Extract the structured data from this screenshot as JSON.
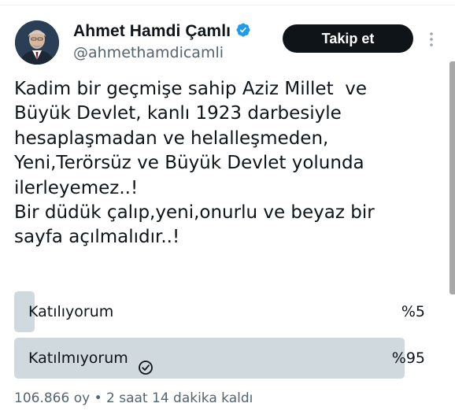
{
  "author": {
    "display_name": "Ahmet Hamdi Çamlı",
    "handle": "@ahmethamdicamli",
    "verified": true
  },
  "follow_button_label": "Takip et",
  "tweet": {
    "text": "Kadim bir geçmişe sahip Aziz Millet  ve\nBüyük Devlet, kanlı 1923 darbesiyle\nhesaplaşmadan ve helalleşmeden,\nYeni,Terörsüz ve Büyük Devlet yolunda\nilerleyemez..!\nBir düdük çalıp,yeni,onurlu ve beyaz bir\nsayfa açılmalıdır..!"
  },
  "poll": {
    "options": [
      {
        "label": "Katılıyorum",
        "percent_text": "%5",
        "percent": 5,
        "selected": false
      },
      {
        "label": "Katılmıyorum",
        "percent_text": "%95",
        "percent": 95,
        "selected": true
      }
    ],
    "votes_text": "106.866 oy",
    "separator": "•",
    "time_left_text": "2 saat 14 dakika kaldı"
  },
  "colors": {
    "verified_badge": "#1d9bf0",
    "poll_fill": "#cfd9de",
    "secondary_text": "#536471",
    "button_bg": "#0f1419"
  },
  "icons": [
    "verified-badge-icon",
    "more-options-icon",
    "selected-check-icon"
  ]
}
